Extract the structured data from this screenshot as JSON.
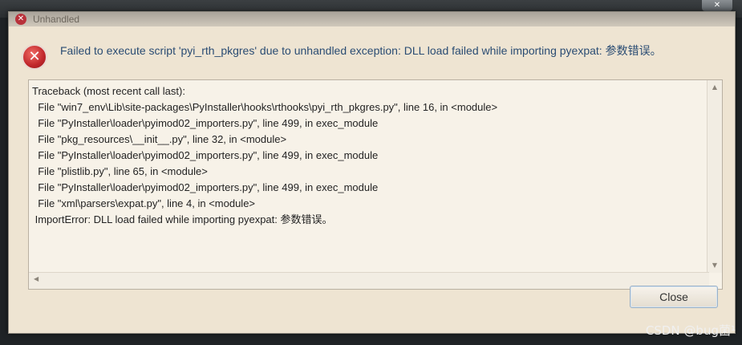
{
  "window": {
    "title": "Unhandled",
    "close_glyph": "✕"
  },
  "dialog": {
    "icon": "error-icon",
    "message": "Failed to execute script 'pyi_rth_pkgres' due to unhandled exception: DLL load failed while importing pyexpat: 参数错误。",
    "traceback_lines": [
      "Traceback (most recent call last):",
      "  File \"win7_env\\Lib\\site-packages\\PyInstaller\\hooks\\rthooks\\pyi_rth_pkgres.py\", line 16, in <module>",
      "  File \"PyInstaller\\loader\\pyimod02_importers.py\", line 499, in exec_module",
      "  File \"pkg_resources\\__init__.py\", line 32, in <module>",
      "  File \"PyInstaller\\loader\\pyimod02_importers.py\", line 499, in exec_module",
      "  File \"plistlib.py\", line 65, in <module>",
      "  File \"PyInstaller\\loader\\pyimod02_importers.py\", line 499, in exec_module",
      "  File \"xml\\parsers\\expat.py\", line 4, in <module>",
      " ImportError: DLL load failed while importing pyexpat: 参数错误。"
    ],
    "close_label": "Close",
    "scroll_up_glyph": "▲",
    "scroll_down_glyph": "▼",
    "scroll_left_glyph": "◀"
  },
  "watermark": "CSDN @bug菌¹"
}
